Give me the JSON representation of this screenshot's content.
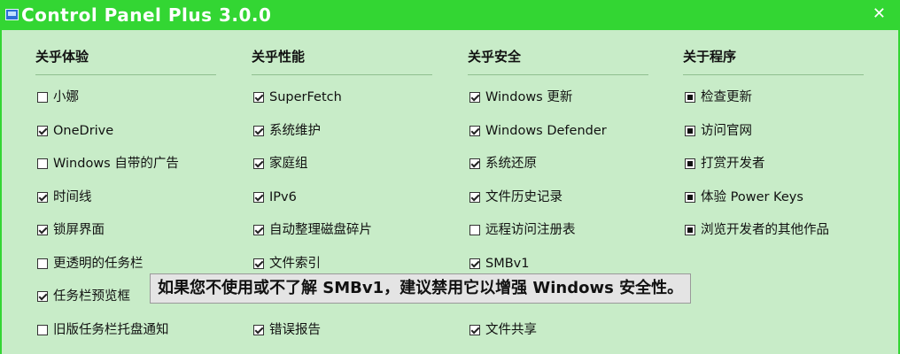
{
  "window": {
    "title": "Control Panel Plus 3.0.0",
    "close_symbol": "✕"
  },
  "colors": {
    "titlebar": "#33d633",
    "background": "#c8ecc8"
  },
  "columns": [
    {
      "header": "关乎体验",
      "items": [
        {
          "label": "小娜",
          "checked": false
        },
        {
          "label": "OneDrive",
          "checked": true
        },
        {
          "label": "Windows 自带的广告",
          "checked": false
        },
        {
          "label": "时间线",
          "checked": true
        },
        {
          "label": "锁屏界面",
          "checked": true
        },
        {
          "label": "更透明的任务栏",
          "checked": false
        },
        {
          "label": "任务栏预览框",
          "checked": true
        },
        {
          "label": "旧版任务栏托盘通知",
          "checked": false
        }
      ]
    },
    {
      "header": "关乎性能",
      "items": [
        {
          "label": "SuperFetch",
          "checked": true
        },
        {
          "label": "系统维护",
          "checked": true
        },
        {
          "label": "家庭组",
          "checked": true
        },
        {
          "label": "IPv6",
          "checked": true
        },
        {
          "label": "自动整理磁盘碎片",
          "checked": true
        },
        {
          "label": "文件索引",
          "checked": true
        },
        {
          "label": "",
          "checked": false,
          "hidden": true
        },
        {
          "label": "错误报告",
          "checked": true
        }
      ]
    },
    {
      "header": "关乎安全",
      "items": [
        {
          "label": "Windows 更新",
          "checked": true
        },
        {
          "label": "Windows Defender",
          "checked": true
        },
        {
          "label": "系统还原",
          "checked": true
        },
        {
          "label": "文件历史记录",
          "checked": true
        },
        {
          "label": "远程访问注册表",
          "checked": false
        },
        {
          "label": "SMBv1",
          "checked": true
        },
        {
          "label": "",
          "checked": false,
          "hidden": true
        },
        {
          "label": "文件共享",
          "checked": true
        }
      ]
    },
    {
      "header": "关于程序",
      "items": [
        {
          "label": "检查更新",
          "filled": true
        },
        {
          "label": "访问官网",
          "filled": true
        },
        {
          "label": "打赏开发者",
          "filled": true
        },
        {
          "label": "体验 Power Keys",
          "filled": true
        },
        {
          "label": "浏览开发者的其他作品",
          "filled": true
        }
      ]
    }
  ],
  "tooltip": {
    "text": "如果您不使用或不了解 SMBv1，建议禁用它以增强 Windows 安全性。"
  }
}
